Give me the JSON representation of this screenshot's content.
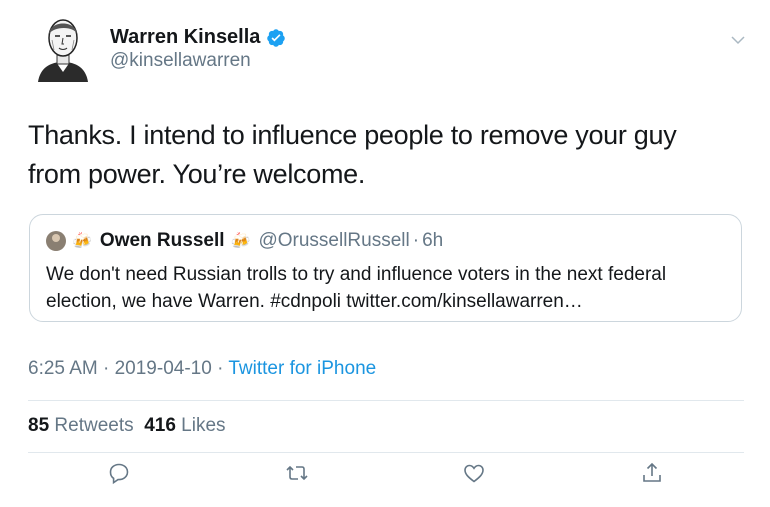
{
  "author": {
    "name": "Warren Kinsella",
    "handle": "@kinsellawarren",
    "verified": true
  },
  "tweet": {
    "text": "Thanks. I intend to influence people to remove your guy from power. You’re welcome."
  },
  "quoted_tweet": {
    "name": "Owen Russell",
    "handle": "@OrussellRussell",
    "time": "6h",
    "text": "We don't need Russian trolls to try and influence voters in the next federal election, we have Warren. #cdnpoli twitter.com/kinsellawarren…"
  },
  "meta": {
    "time": "6:25 AM",
    "date": "2019-04-10",
    "source": "Twitter for iPhone"
  },
  "stats": {
    "retweets_count": "85",
    "retweets_label": "Retweets",
    "likes_count": "416",
    "likes_label": "Likes"
  },
  "icons": [
    "avatar",
    "verified-icon",
    "chevron-down-icon",
    "beer-emoji",
    "reply-icon",
    "retweet-icon",
    "like-icon",
    "share-icon"
  ],
  "colors": {
    "accent": "#1b95e0",
    "text": "#14171a",
    "secondary": "#657786",
    "border": "#e1e8ed"
  }
}
